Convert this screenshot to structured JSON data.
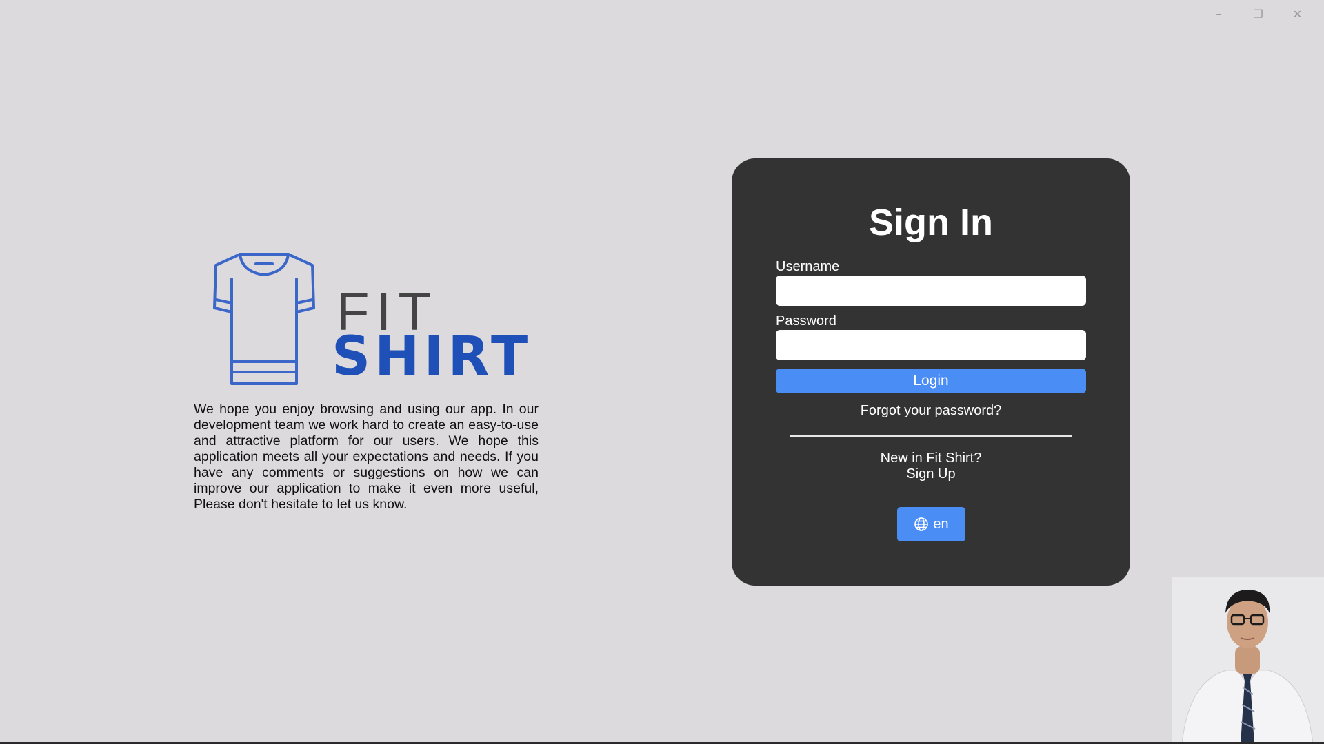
{
  "window": {
    "minimize_icon": "minimize-icon",
    "restore_icon": "restore-icon",
    "close_icon": "close-icon"
  },
  "brand": {
    "logo_line1": "FIT",
    "logo_line2": "SHIRT",
    "colors": {
      "logo_blue": "#1e50b8",
      "shirt_outline": "#3b67c9"
    }
  },
  "intro": {
    "text": "We hope you enjoy browsing and using our app. In our development team we work hard to create an easy-to-use and attractive platform for our users. We hope this application meets all your expectations and needs. If you have any comments or suggestions on how we can improve our application to make it even more useful, Please don't hesitate to let us know."
  },
  "signin": {
    "title": "Sign In",
    "username_label": "Username",
    "username_value": "",
    "password_label": "Password",
    "password_value": "",
    "login_label": "Login",
    "forgot_label": "Forgot your password?",
    "new_in_label": "New in Fit Shirt?",
    "signup_label": "Sign Up",
    "language_label": "en",
    "language_icon": "globe-icon",
    "colors": {
      "card_bg": "#333333",
      "accent": "#4a8df5"
    }
  }
}
